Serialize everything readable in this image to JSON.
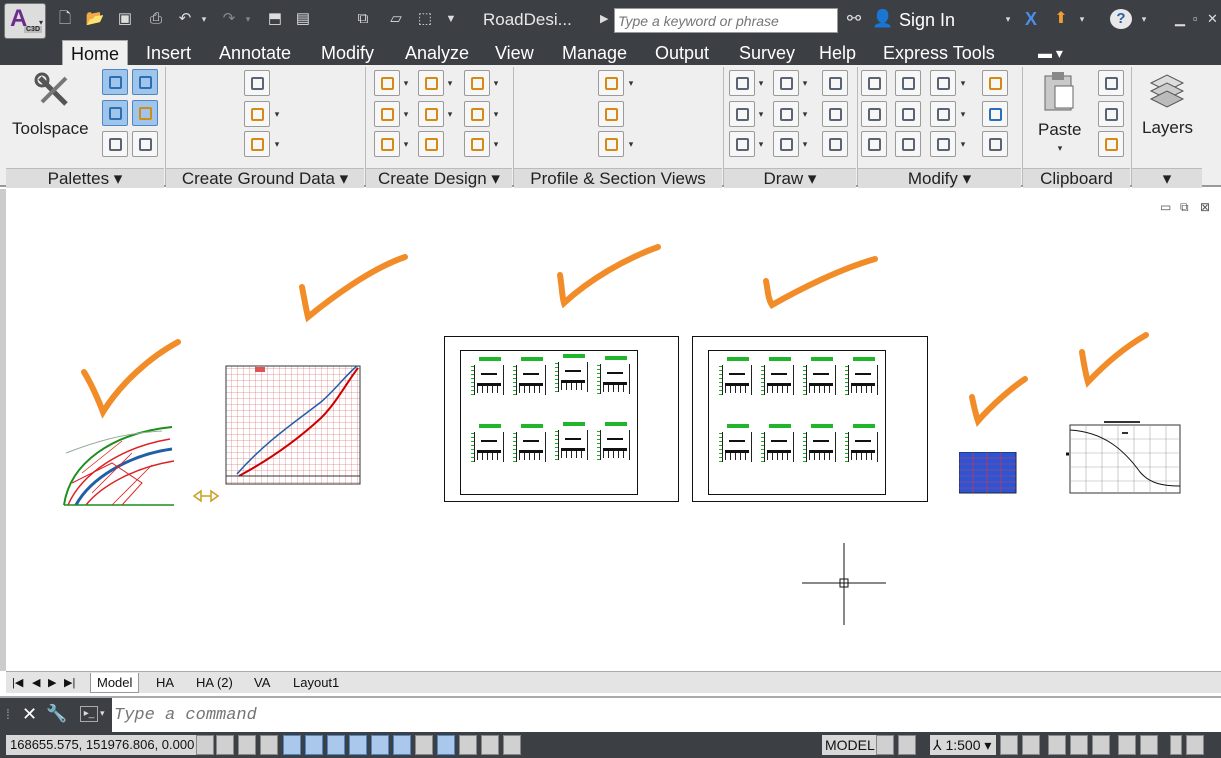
{
  "title_bar": {
    "product_badge": "C3D",
    "document_title": "RoadDesi...",
    "search_placeholder": "Type a keyword or phrase",
    "sign_in": "Sign In",
    "help": "?"
  },
  "ribbon_tabs": [
    "Home",
    "Insert",
    "Annotate",
    "Modify",
    "Analyze",
    "View",
    "Manage",
    "Output",
    "Survey",
    "Help",
    "Express Tools"
  ],
  "panels": {
    "palettes": "Palettes",
    "ground": "Create Ground Data",
    "design": "Create Design",
    "profile": "Profile & Section Views",
    "draw": "Draw",
    "modify": "Modify",
    "clipboard": "Clipboard"
  },
  "buttons": {
    "toolspace": "Toolspace",
    "paste": "Paste",
    "layers": "Layers"
  },
  "layout_tabs": [
    "Model",
    "HA",
    "HA (2)",
    "VA",
    "Layout1"
  ],
  "command": {
    "placeholder": "Type a command"
  },
  "status": {
    "coordinates": "168655.575, 151976.806, 0.000",
    "space": "MODEL",
    "scale": "1:500"
  },
  "colors": {
    "chrome": "#3c3f44",
    "ribbon": "#efefef",
    "annotation_check": "#f28c28",
    "section_title": "#1fb62c",
    "profile_red": "#c00000",
    "profile_blue": "#1f5fa8",
    "table_blue": "#2a55d6"
  }
}
